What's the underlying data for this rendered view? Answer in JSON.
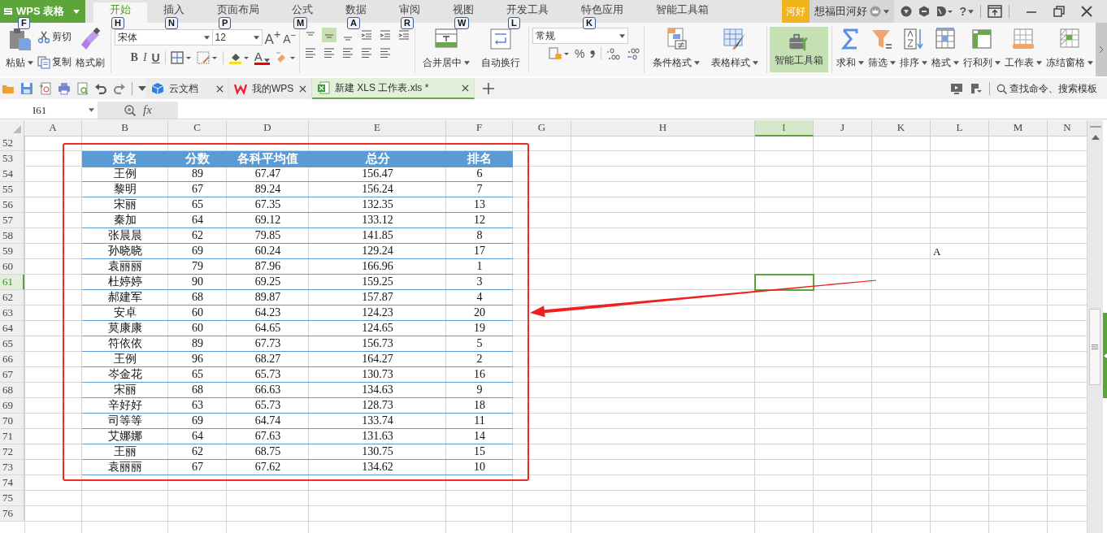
{
  "title_bar": {
    "app_button": {
      "label": "WPS 表格",
      "key_tip": "F"
    },
    "tabs": [
      {
        "label": "开始",
        "key_tip": "H",
        "selected": true
      },
      {
        "label": "插入",
        "key_tip": "N",
        "selected": false
      },
      {
        "label": "页面布局",
        "key_tip": "P",
        "selected": false
      },
      {
        "label": "公式",
        "key_tip": "M",
        "selected": false
      },
      {
        "label": "数据",
        "key_tip": "A",
        "selected": false
      },
      {
        "label": "审阅",
        "key_tip": "R",
        "selected": false
      },
      {
        "label": "视图",
        "key_tip": "W",
        "selected": false
      },
      {
        "label": "开发工具",
        "key_tip": "L",
        "selected": false
      },
      {
        "label": "特色应用",
        "key_tip": "K",
        "selected": false
      },
      {
        "label": "智能工具箱",
        "selected": false
      }
    ],
    "account": {
      "badge": "河好",
      "name": "想福田河好",
      "help": "?"
    }
  },
  "ribbon": {
    "paste": "粘贴",
    "cut": "剪切",
    "copy": "复制",
    "format_painter": "格式刷",
    "font_name": "宋体",
    "font_size": "12",
    "grow_font": "A$^{+}$",
    "shrink_font": "A$^{−}$",
    "bold": "B",
    "italic": "I",
    "underline": "U",
    "font_color": "A",
    "merge_center": "合并居中",
    "wrap_text": "自动换行",
    "number_format": "常规",
    "percent": "%",
    "conditional_format": "条件格式",
    "table_style": "表格样式",
    "toolbox": {
      "label": "智能工具箱",
      "selected": true
    },
    "tools": [
      "求和",
      "筛选",
      "排序",
      "格式",
      "行和列",
      "工作表",
      "冻结窗格"
    ]
  },
  "document_tabs": [
    {
      "label": "云文档",
      "selected": false
    },
    {
      "label": "我的WPS",
      "selected": false
    },
    {
      "label": "新建 XLS 工作表.xls *",
      "selected": true
    }
  ],
  "command_search": {
    "placeholder": "查找命令、搜索模板"
  },
  "formula_bar": {
    "name_box": "I61",
    "fx": "fx"
  },
  "sheet": {
    "columns": [
      {
        "label": "A",
        "selected": false
      },
      {
        "label": "B",
        "selected": false
      },
      {
        "label": "C",
        "selected": false
      },
      {
        "label": "D",
        "selected": false
      },
      {
        "label": "E",
        "selected": false
      },
      {
        "label": "F",
        "selected": false
      },
      {
        "label": "G",
        "selected": false
      },
      {
        "label": "H",
        "selected": false
      },
      {
        "label": "I",
        "selected": true
      },
      {
        "label": "J",
        "selected": false
      },
      {
        "label": "K",
        "selected": false
      },
      {
        "label": "L",
        "selected": false
      },
      {
        "label": "M",
        "selected": false
      },
      {
        "label": "N",
        "selected": false
      }
    ],
    "rows": [
      {
        "number": "52",
        "selected": false,
        "kind": "plain"
      },
      {
        "number": "53",
        "selected": false,
        "kind": "table-header",
        "values": [
          "姓名",
          "分数",
          "各科平均值",
          "总分",
          "排名"
        ]
      },
      {
        "number": "54",
        "selected": false,
        "kind": "table-row",
        "values": [
          "王例",
          "89",
          "67.47",
          "156.47",
          "6"
        ]
      },
      {
        "number": "55",
        "selected": false,
        "kind": "table-row",
        "values": [
          "黎明",
          "67",
          "89.24",
          "156.24",
          "7"
        ]
      },
      {
        "number": "56",
        "selected": false,
        "kind": "table-row",
        "values": [
          "宋丽",
          "65",
          "67.35",
          "132.35",
          "13"
        ]
      },
      {
        "number": "57",
        "selected": false,
        "kind": "table-row",
        "values": [
          "秦加",
          "64",
          "69.12",
          "133.12",
          "12"
        ]
      },
      {
        "number": "58",
        "selected": false,
        "kind": "table-row",
        "values": [
          "张晨晨",
          "62",
          "79.85",
          "141.85",
          "8"
        ]
      },
      {
        "number": "59",
        "selected": false,
        "kind": "table-row",
        "values": [
          "孙晓晓",
          "69",
          "60.24",
          "129.24",
          "17"
        ],
        "extra_cells": [
          {
            "value": "A"
          }
        ]
      },
      {
        "number": "60",
        "selected": false,
        "kind": "table-row",
        "values": [
          "袁丽丽",
          "79",
          "87.96",
          "166.96",
          "1"
        ]
      },
      {
        "number": "61",
        "selected": true,
        "kind": "table-row",
        "values": [
          "杜婷婷",
          "90",
          "69.25",
          "159.25",
          "3"
        ]
      },
      {
        "number": "62",
        "selected": false,
        "kind": "table-row",
        "values": [
          "郝建军",
          "68",
          "89.87",
          "157.87",
          "4"
        ]
      },
      {
        "number": "63",
        "selected": false,
        "kind": "table-row",
        "values": [
          "安卓",
          "60",
          "64.23",
          "124.23",
          "20"
        ]
      },
      {
        "number": "64",
        "selected": false,
        "kind": "table-row",
        "values": [
          "莫康康",
          "60",
          "64.65",
          "124.65",
          "19"
        ]
      },
      {
        "number": "65",
        "selected": false,
        "kind": "table-row",
        "values": [
          "符依依",
          "89",
          "67.73",
          "156.73",
          "5"
        ]
      },
      {
        "number": "66",
        "selected": false,
        "kind": "table-row",
        "values": [
          "王例",
          "96",
          "68.27",
          "164.27",
          "2"
        ]
      },
      {
        "number": "67",
        "selected": false,
        "kind": "table-row",
        "values": [
          "岑金花",
          "65",
          "65.73",
          "130.73",
          "16"
        ]
      },
      {
        "number": "68",
        "selected": false,
        "kind": "table-row",
        "values": [
          "宋丽",
          "68",
          "66.63",
          "134.63",
          "9"
        ]
      },
      {
        "number": "69",
        "selected": false,
        "kind": "table-row",
        "values": [
          "辛好好",
          "63",
          "65.73",
          "128.73",
          "18"
        ]
      },
      {
        "number": "70",
        "selected": false,
        "kind": "table-row",
        "values": [
          "司等等",
          "69",
          "64.74",
          "133.74",
          "11"
        ]
      },
      {
        "number": "71",
        "selected": false,
        "kind": "table-row",
        "values": [
          "艾娜娜",
          "64",
          "67.63",
          "131.63",
          "14"
        ]
      },
      {
        "number": "72",
        "selected": false,
        "kind": "table-row",
        "values": [
          "王丽",
          "62",
          "68.75",
          "130.75",
          "15"
        ]
      },
      {
        "number": "73",
        "selected": false,
        "kind": "table-row",
        "values": [
          "袁丽丽",
          "67",
          "67.62",
          "134.62",
          "10"
        ]
      },
      {
        "number": "74",
        "selected": false,
        "kind": "plain"
      },
      {
        "number": "75",
        "selected": false,
        "kind": "plain"
      },
      {
        "number": "76",
        "selected": false,
        "kind": "plain"
      }
    ]
  },
  "annotations": {
    "highlight_frame": true,
    "arrow": true
  }
}
